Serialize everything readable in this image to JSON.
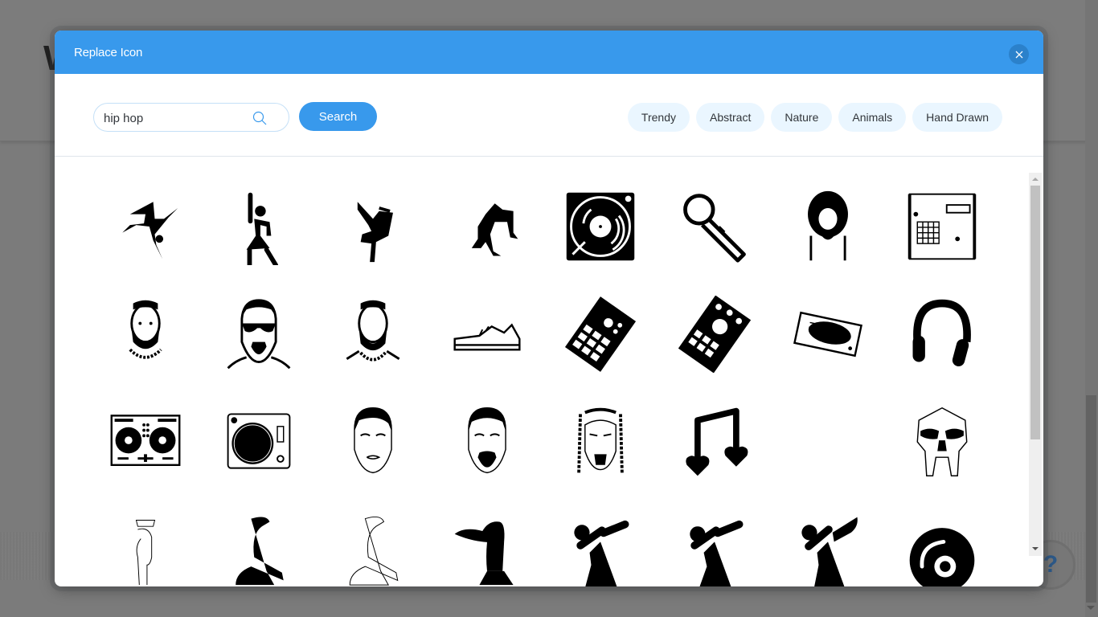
{
  "background": {
    "title_fragment": "W",
    "help_label": "?"
  },
  "modal": {
    "title": "Replace Icon",
    "close_label": "close"
  },
  "search": {
    "value": "hip hop",
    "placeholder": "Search",
    "button_label": "Search"
  },
  "tags": [
    "Trendy",
    "Abstract",
    "Nature",
    "Animals",
    "Hand Drawn"
  ],
  "icons": [
    "breakdance-spin-icon",
    "dancing-figure-icon",
    "breakdance-freeze-icon",
    "backbend-dancer-icon",
    "turntable-icon",
    "microphone-icon",
    "afro-beard-man-icon",
    "drum-machine-icon",
    "bearded-rapper-chain-icon",
    "sunglasses-rapper-icon",
    "bearded-man-chain-icon",
    "sneaker-icon",
    "beat-pad-icon",
    "sampler-pad-icon",
    "record-player-icon",
    "headphones-icon",
    "dj-controller-icon",
    "vinyl-deck-icon",
    "young-man-face-icon",
    "goatee-man-face-icon",
    "braided-man-face-icon",
    "music-note-hearts-icon",
    "blank-icon",
    "metal-mask-icon",
    "sketch-man-cap-icon",
    "crouching-figure-icon",
    "crouching-figure-outline-icon",
    "cap-head-icon",
    "dab-pose-icon",
    "dab-pose-2-icon",
    "dab-pose-3-icon",
    "record-disc-icon"
  ],
  "colors": {
    "accent": "#3899ec",
    "close_bg": "#2b81cb",
    "tag_bg": "#eaf6ff"
  }
}
